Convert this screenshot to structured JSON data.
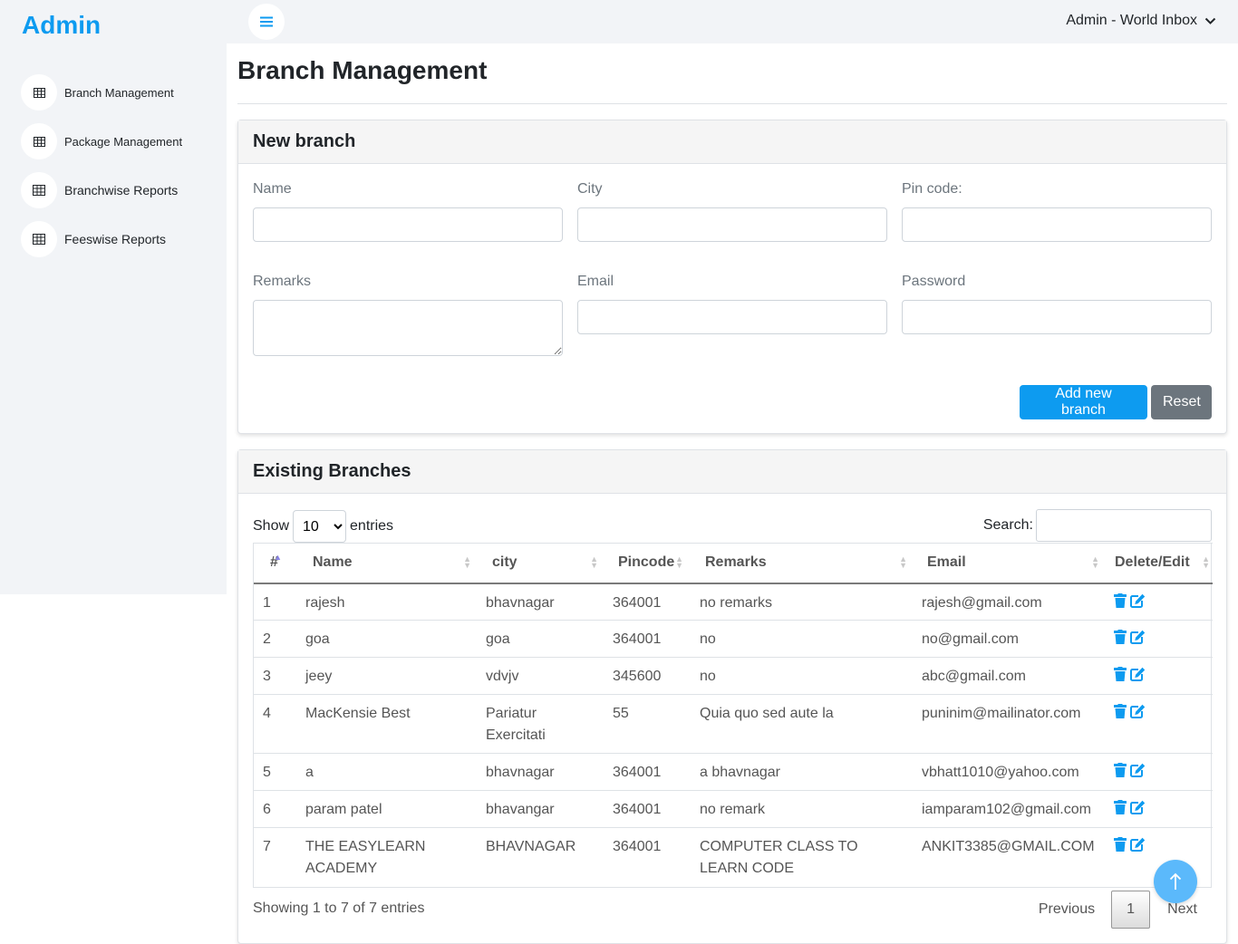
{
  "brand": "Admin",
  "sidebar": {
    "items": [
      {
        "label": "Branch Management",
        "icon": "table-icon"
      },
      {
        "label": "Package Management",
        "icon": "table-icon"
      },
      {
        "label": "Branchwise Reports",
        "icon": "table-icon"
      },
      {
        "label": "Feeswise Reports",
        "icon": "table-icon"
      }
    ]
  },
  "topbar": {
    "user_label": "Admin - World Inbox"
  },
  "page": {
    "title": "Branch Management"
  },
  "new_branch": {
    "title": "New branch",
    "fields": {
      "name": {
        "label": "Name",
        "value": ""
      },
      "city": {
        "label": "City",
        "value": ""
      },
      "pincode": {
        "label": "Pin code:",
        "value": ""
      },
      "remarks": {
        "label": "Remarks",
        "value": ""
      },
      "email": {
        "label": "Email",
        "value": ""
      },
      "password": {
        "label": "Password",
        "value": ""
      }
    },
    "add_label": "Add new branch",
    "reset_label": "Reset"
  },
  "existing": {
    "title": "Existing Branches",
    "length": {
      "show": "Show",
      "value": "10",
      "entries": "entries"
    },
    "search_label": "Search:",
    "columns": [
      "#",
      "Name",
      "city",
      "Pincode",
      "Remarks",
      "Email",
      "Delete/Edit"
    ],
    "rows": [
      {
        "num": "1",
        "name": "rajesh",
        "city": "bhavnagar",
        "pincode": "364001",
        "remarks": "no remarks",
        "email": "rajesh@gmail.com"
      },
      {
        "num": "2",
        "name": "goa",
        "city": "goa",
        "pincode": "364001",
        "remarks": "no",
        "email": "no@gmail.com"
      },
      {
        "num": "3",
        "name": "jeey",
        "city": "vdvjv",
        "pincode": "345600",
        "remarks": "no",
        "email": "abc@gmail.com"
      },
      {
        "num": "4",
        "name": "MacKensie Best",
        "city": "Pariatur Exercitati",
        "pincode": "55",
        "remarks": "Quia quo sed aute la",
        "email": "puninim@mailinator.com"
      },
      {
        "num": "5",
        "name": "a",
        "city": "bhavnagar",
        "pincode": "364001",
        "remarks": "a bhavnagar",
        "email": "vbhatt1010@yahoo.com"
      },
      {
        "num": "6",
        "name": "param patel",
        "city": "bhavangar",
        "pincode": "364001",
        "remarks": "no remark",
        "email": "iamparam102@gmail.com"
      },
      {
        "num": "7",
        "name": "THE EASYLEARN ACADEMY",
        "city": "BHAVNAGAR",
        "pincode": "364001",
        "remarks": "COMPUTER CLASS TO LEARN CODE",
        "email": "ANKIT3385@GMAIL.COM"
      }
    ],
    "info": "Showing 1 to 7 of 7 entries",
    "pager": {
      "previous": "Previous",
      "current": "1",
      "next": "Next"
    }
  },
  "colors": {
    "accent": "#0d9bf0",
    "secondary": "#6c757d",
    "sidebar_bg": "#f2f4f7"
  }
}
